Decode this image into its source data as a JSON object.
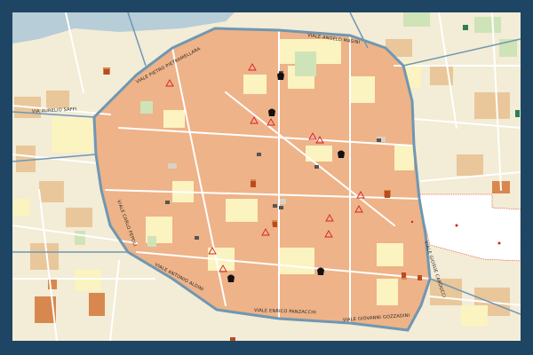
{
  "map": {
    "colors": {
      "frame": "#1e4563",
      "background": "#f3ecd6",
      "block_land": "#e9a877",
      "historic_center_block": "#eeb388",
      "pale_yellow_block": "#fbf3c0",
      "light_yellow_block": "#f6eab0",
      "gray_block": "#d9d2c2",
      "water": "#b7cdd7",
      "green": "#cfe3b8",
      "dark_green": "#2e7d54",
      "ring_road": "#6f97b2",
      "minor_road": "#ffffff",
      "symbol_red": "#d61f26",
      "symbol_brown": "#b84d20",
      "white_area": "#ffffff"
    },
    "street_labels": [
      {
        "id": "aurelio-saffi",
        "text": "VIA AURELIO SAFFI"
      },
      {
        "id": "pietro-pietramellara",
        "text": "VIALE PIETRO PIETRAMELLARA"
      },
      {
        "id": "angelo-masini",
        "text": "VIALE ANGELO MASINI"
      },
      {
        "id": "carlo-pepoli",
        "text": "VIALE CARLO PEPOLI"
      },
      {
        "id": "antonio-aldini",
        "text": "VIALE ANTONIO ALDINI"
      },
      {
        "id": "enrico-panzacchi",
        "text": "VIALE ENRICO PANZACCHI"
      },
      {
        "id": "giovanni-gozzadini",
        "text": "VIALE GIOVANNI GOZZADINI"
      },
      {
        "id": "giosue-carducci",
        "text": "VIALE GIOSUE CARDUCCI"
      }
    ],
    "symbols": {
      "churches": 13,
      "museums": 8,
      "theaters": 4,
      "hotels": 7
    }
  }
}
